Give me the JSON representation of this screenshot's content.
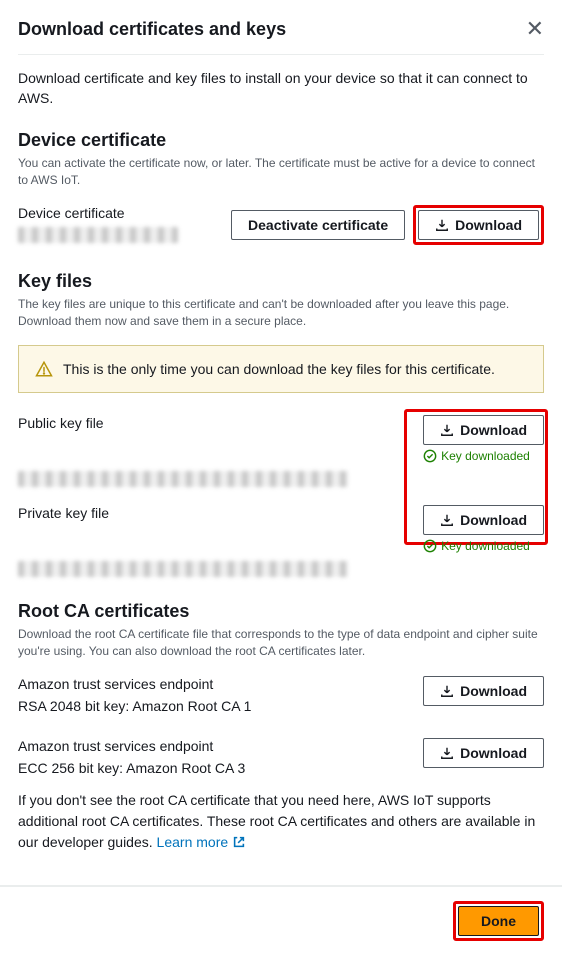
{
  "header": {
    "title": "Download certificates and keys"
  },
  "intro": "Download certificate and key files to install on your device so that it can connect to AWS.",
  "deviceCert": {
    "title": "Device certificate",
    "desc": "You can activate the certificate now, or later. The certificate must be active for a device to connect to AWS IoT.",
    "label": "Device certificate",
    "deactivateBtn": "Deactivate certificate",
    "downloadBtn": "Download"
  },
  "keyFiles": {
    "title": "Key files",
    "desc": "The key files are unique to this certificate and can't be downloaded after you leave this page. Download them now and save them in a secure place.",
    "alert": "This is the only time you can download the key files for this certificate.",
    "publicLabel": "Public key file",
    "privateLabel": "Private key file",
    "downloadBtn": "Download",
    "downloadedStatus": "Key downloaded"
  },
  "rootCA": {
    "title": "Root CA certificates",
    "desc": "Download the root CA certificate file that corresponds to the type of data endpoint and cipher suite you're using. You can also download the root CA certificates later.",
    "endpoint1Label": "Amazon trust services endpoint",
    "endpoint1Key": "RSA 2048 bit key: Amazon Root CA 1",
    "endpoint2Label": "Amazon trust services endpoint",
    "endpoint2Key": "ECC 256 bit key: Amazon Root CA 3",
    "downloadBtn": "Download",
    "footnote": "If you don't see the root CA certificate that you need here, AWS IoT supports additional root CA certificates. These root CA certificates and others are available in our developer guides. ",
    "learnMore": "Learn more"
  },
  "footer": {
    "done": "Done"
  }
}
